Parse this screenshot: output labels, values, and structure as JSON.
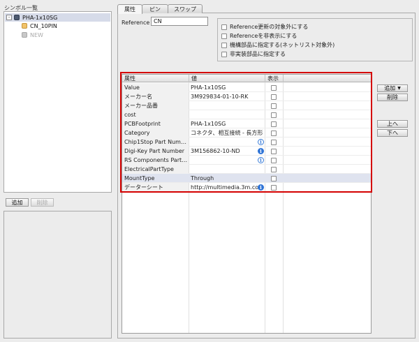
{
  "symbol_list": {
    "title": "シンボル一覧",
    "tree": [
      {
        "label": "PHA-1x10SG",
        "toggle": "-",
        "icon": "component-chip-icon"
      },
      {
        "label": "CN_10PIN",
        "icon": "symbol-part-icon"
      },
      {
        "label": "NEW",
        "icon": "new-symbol-icon"
      }
    ],
    "add_button": "追加",
    "delete_button": "削除"
  },
  "tabs": [
    "属性",
    "ピン",
    "スワップ"
  ],
  "reference": {
    "label": "Reference",
    "value": "CN"
  },
  "options": [
    "Reference更新の対象外にする",
    "Referenceを非表示にする",
    "機構部品に指定する(ネットリスト対象外)",
    "非実装部品に指定する"
  ],
  "grid": {
    "headers": {
      "name": "属性",
      "value": "値",
      "display": "表示"
    },
    "rows": [
      {
        "name": "Value",
        "value": "PHA-1x10SG",
        "info": ""
      },
      {
        "name": "メーカー名",
        "value": "3M929834-01-10-RK",
        "info": ""
      },
      {
        "name": "メーカー品番",
        "value": "",
        "info": ""
      },
      {
        "name": "cost",
        "value": "",
        "info": ""
      },
      {
        "name": "PCBFootprint",
        "value": "PHA-1x10SG",
        "info": ""
      },
      {
        "name": "Category",
        "value": "コネクタ、相互接続 - 長方形",
        "info": ""
      },
      {
        "name": "Chip1Stop Part Num…",
        "value": "",
        "info": "outline"
      },
      {
        "name": "Digi-Key Part Number",
        "value": "3M156862-10-ND",
        "info": "filled"
      },
      {
        "name": "RS Components Part…",
        "value": "",
        "info": "outline"
      },
      {
        "name": "ElectricalPartType",
        "value": "",
        "info": ""
      },
      {
        "name": "MountType",
        "value": "Through",
        "info": ""
      },
      {
        "name": "データーシート",
        "value": "http://multimedia.3m.co",
        "info": "filled"
      }
    ],
    "selected_row": 10
  },
  "side_buttons": {
    "add": "追加",
    "add_arrow": "▼",
    "delete": "削除",
    "up": "上へ",
    "down": "下へ"
  },
  "colors": {
    "highlight_border": "#d40000",
    "selection": "#dfe3ef",
    "info_icon": "#2f74d6"
  }
}
